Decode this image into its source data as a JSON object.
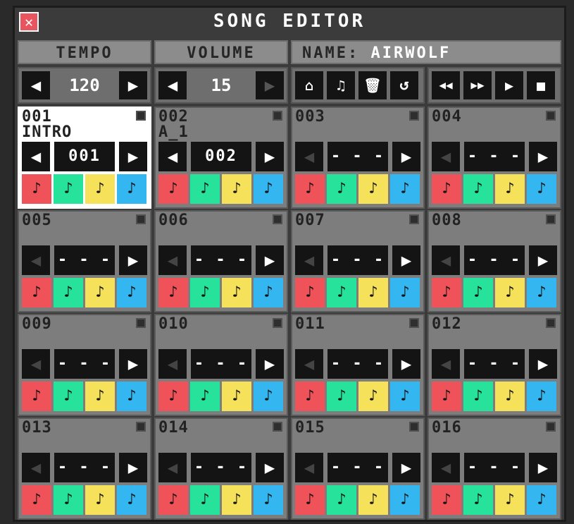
{
  "window": {
    "title": "SONG EDITOR",
    "close_glyph": "✕"
  },
  "headers": {
    "tempo": "TEMPO",
    "volume": "VOLUME",
    "name_label": "NAME:",
    "name_value": "AIRWOLF"
  },
  "tempo": {
    "value": "120",
    "dec_glyph": "◀",
    "inc_glyph": "▶"
  },
  "volume": {
    "value": "15",
    "dec_glyph": "◀",
    "inc_glyph": "▶"
  },
  "tools": {
    "piano_icon": "⌂",
    "note_icon": "♫",
    "trash_icon": "🗑",
    "undo_icon": "↺",
    "rewind_icon": "◀◀",
    "ffwd_icon": "▶▶",
    "play_icon": "▶",
    "stop_icon": "■"
  },
  "track_colors": [
    "#ef5258",
    "#27e29a",
    "#f6e25a",
    "#34b6f0"
  ],
  "note_glyph": "♪",
  "patterns": [
    {
      "num": "001",
      "label": "INTRO",
      "value": "001",
      "selected": true,
      "has_prev": true
    },
    {
      "num": "002",
      "label": "A_1",
      "value": "002",
      "selected": false,
      "has_prev": true
    },
    {
      "num": "003",
      "label": "",
      "value": "- - -",
      "selected": false,
      "has_prev": false
    },
    {
      "num": "004",
      "label": "",
      "value": "- - -",
      "selected": false,
      "has_prev": false
    },
    {
      "num": "005",
      "label": "",
      "value": "- - -",
      "selected": false,
      "has_prev": false
    },
    {
      "num": "006",
      "label": "",
      "value": "- - -",
      "selected": false,
      "has_prev": false
    },
    {
      "num": "007",
      "label": "",
      "value": "- - -",
      "selected": false,
      "has_prev": false
    },
    {
      "num": "008",
      "label": "",
      "value": "- - -",
      "selected": false,
      "has_prev": false
    },
    {
      "num": "009",
      "label": "",
      "value": "- - -",
      "selected": false,
      "has_prev": false
    },
    {
      "num": "010",
      "label": "",
      "value": "- - -",
      "selected": false,
      "has_prev": false
    },
    {
      "num": "011",
      "label": "",
      "value": "- - -",
      "selected": false,
      "has_prev": false
    },
    {
      "num": "012",
      "label": "",
      "value": "- - -",
      "selected": false,
      "has_prev": false
    },
    {
      "num": "013",
      "label": "",
      "value": "- - -",
      "selected": false,
      "has_prev": false
    },
    {
      "num": "014",
      "label": "",
      "value": "- - -",
      "selected": false,
      "has_prev": false
    },
    {
      "num": "015",
      "label": "",
      "value": "- - -",
      "selected": false,
      "has_prev": false
    },
    {
      "num": "016",
      "label": "",
      "value": "- - -",
      "selected": false,
      "has_prev": false
    }
  ]
}
